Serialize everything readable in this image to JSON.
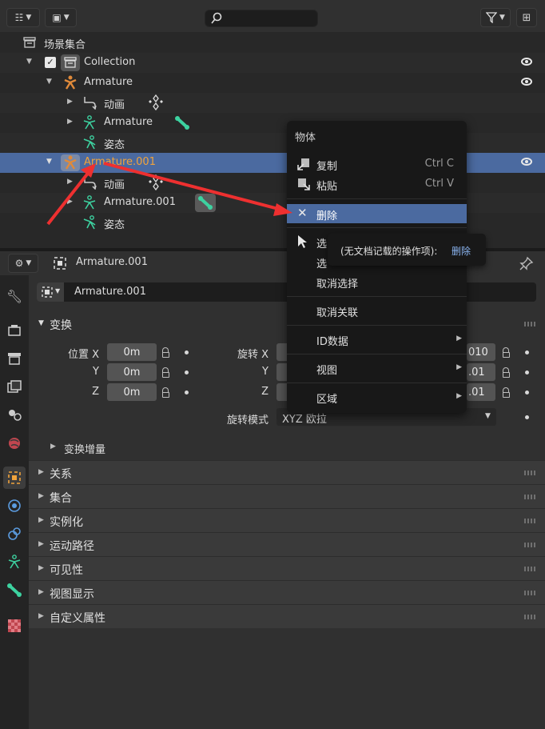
{
  "outliner": {
    "header": {
      "editor_type_icon": "outliner-icon",
      "display_mode_icon": "display-mode-icon",
      "search_placeholder": "",
      "filter_icon": "filter-icon",
      "new_collection_icon": "new-collection-icon"
    },
    "rows": [
      {
        "label": "场景集合",
        "icon": "scene-collection-icon"
      },
      {
        "label": "Collection",
        "icon": "collection-icon"
      },
      {
        "label": "Armature",
        "icon": "armature-object-icon"
      },
      {
        "label": "动画",
        "icon": "animation-icon"
      },
      {
        "label": "Armature",
        "icon": "armature-data-icon"
      },
      {
        "label": "姿态",
        "icon": "pose-icon"
      },
      {
        "label": "Armature.001",
        "icon": "armature-object-icon"
      },
      {
        "label": "动画",
        "icon": "animation-icon"
      },
      {
        "label": "Armature.001",
        "icon": "armature-data-icon"
      },
      {
        "label": "姿态",
        "icon": "pose-icon"
      }
    ]
  },
  "properties": {
    "header_name": "Armature.001",
    "object_name": "Armature.001",
    "transform": {
      "title": "变换",
      "location_labels": [
        "位置 X",
        "Y",
        "Z"
      ],
      "location_values": [
        "0m",
        "0m",
        "0m"
      ],
      "rotation_labels": [
        "旋转 X",
        "Y",
        "Z"
      ],
      "scale_values_visible": [
        "010",
        ".01",
        ".01"
      ],
      "rotation_mode_label": "旋转模式",
      "rotation_mode_value": "XYZ 欧拉",
      "delta_title": "变换增量"
    },
    "panels": [
      "关系",
      "集合",
      "实例化",
      "运动路径",
      "可见性",
      "视图显示",
      "自定义属性"
    ]
  },
  "context_menu": {
    "title": "物体",
    "items": [
      {
        "label": "复制",
        "shortcut": "Ctrl C"
      },
      {
        "label": "粘贴",
        "shortcut": "Ctrl V"
      },
      {
        "label": "删除",
        "shortcut": ""
      },
      {
        "label": "选",
        "shortcut": ""
      },
      {
        "label": "选",
        "shortcut": ""
      },
      {
        "label": "取消选择",
        "shortcut": ""
      },
      {
        "label": "取消关联",
        "shortcut": ""
      },
      {
        "label": "ID数据",
        "shortcut": ""
      },
      {
        "label": "视图",
        "shortcut": ""
      },
      {
        "label": "区域",
        "shortcut": ""
      }
    ]
  },
  "tooltip": {
    "text": "(无文档记载的操作项):",
    "action": "删除"
  },
  "colors": {
    "selection": "#4b6aa0",
    "highlight_text": "#f0a33c",
    "armature_orange": "#e08a3a",
    "bone_green": "#3dd2a0",
    "arrow_red": "#ee3030"
  }
}
